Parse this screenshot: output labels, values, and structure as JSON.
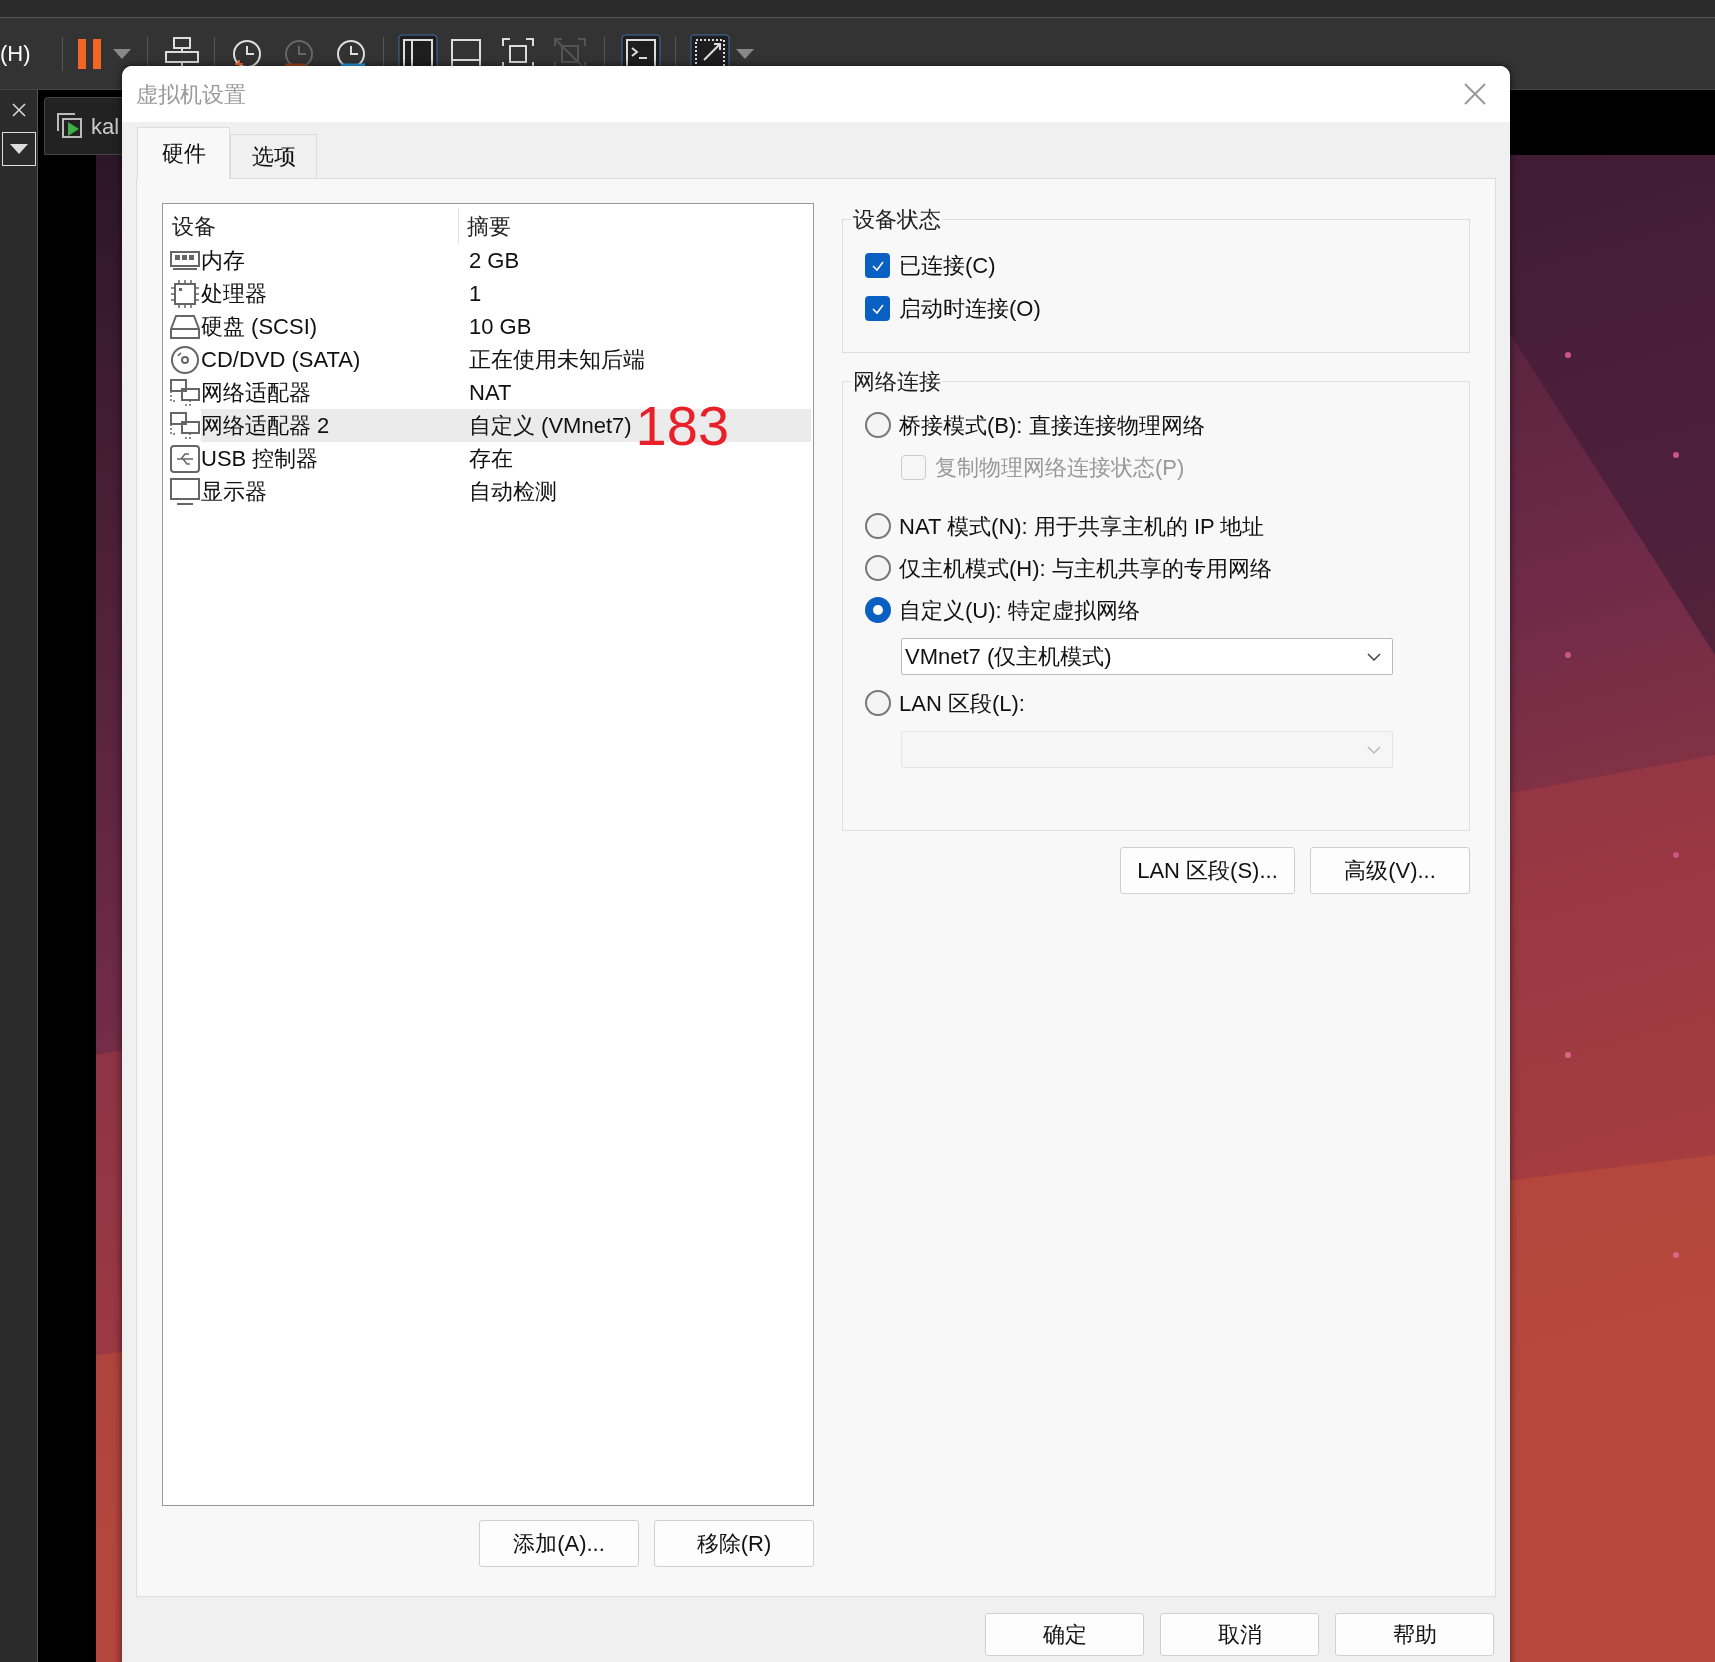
{
  "app": {
    "menu_fragment": "(H)",
    "vm_tab": "kal"
  },
  "dialog": {
    "title": "虚拟机设置",
    "tabs": [
      {
        "label": "硬件",
        "selected": true
      },
      {
        "label": "选项",
        "selected": false
      }
    ],
    "device_table": {
      "columns": [
        "设备",
        "摘要"
      ],
      "rows": [
        {
          "kind": "memory",
          "device": "内存",
          "summary": "2 GB",
          "selected": false
        },
        {
          "kind": "cpu",
          "device": "处理器",
          "summary": "1",
          "selected": false
        },
        {
          "kind": "disk",
          "device": "硬盘 (SCSI)",
          "summary": "10 GB",
          "selected": false
        },
        {
          "kind": "cd",
          "device": "CD/DVD (SATA)",
          "summary": "正在使用未知后端",
          "selected": false
        },
        {
          "kind": "network",
          "device": "网络适配器",
          "summary": "NAT",
          "selected": false
        },
        {
          "kind": "network",
          "device": "网络适配器 2",
          "summary": "自定义 (VMnet7)",
          "selected": true,
          "annotation": "183"
        },
        {
          "kind": "usb",
          "device": "USB 控制器",
          "summary": "存在",
          "selected": false
        },
        {
          "kind": "display",
          "device": "显示器",
          "summary": "自动检测",
          "selected": false
        }
      ]
    },
    "list_buttons": [
      "添加(A)...",
      "移除(R)"
    ],
    "device_status": {
      "title": "设备状态",
      "checkboxes": [
        {
          "label": "已连接(C)",
          "checked": true
        },
        {
          "label": "启动时连接(O)",
          "checked": true
        }
      ]
    },
    "network": {
      "title": "网络连接",
      "items": [
        {
          "kind": "radio",
          "label": "桥接模式(B): 直接连接物理网络",
          "selected": false
        },
        {
          "kind": "checkbox",
          "label": "复制物理网络连接状态(P)",
          "checked": false,
          "disabled": true
        },
        {
          "kind": "radio",
          "label": "NAT 模式(N): 用于共享主机的 IP 地址",
          "selected": false
        },
        {
          "kind": "radio",
          "label": "仅主机模式(H): 与主机共享的专用网络",
          "selected": false
        },
        {
          "kind": "radio",
          "label": "自定义(U): 特定虚拟网络",
          "selected": true
        },
        {
          "kind": "select",
          "value": "VMnet7 (仅主机模式)",
          "disabled": false
        },
        {
          "kind": "radio",
          "label": "LAN 区段(L):",
          "selected": false
        },
        {
          "kind": "select",
          "disabled": true
        }
      ]
    },
    "network_buttons": [
      "LAN 区段(S)...",
      "高级(V)..."
    ],
    "footer_buttons": [
      "确定",
      "取消",
      "帮助"
    ]
  }
}
